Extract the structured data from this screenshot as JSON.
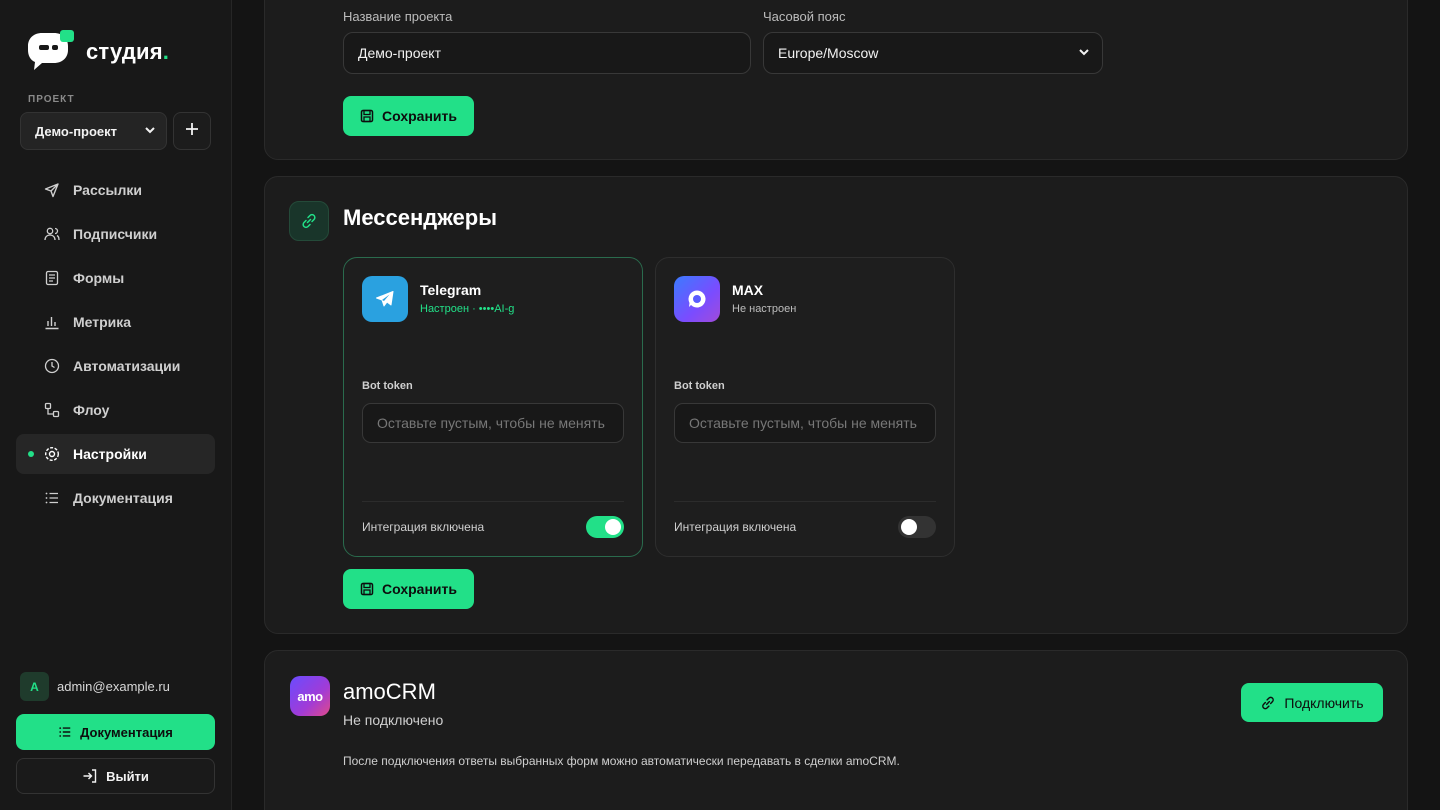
{
  "brand": {
    "name": "студия",
    "dot": ".",
    "accent": "#22e088"
  },
  "sidebar": {
    "project_label": "ПРОЕКТ",
    "project_select": "Демо-проект",
    "nav": [
      {
        "label": "Рассылки",
        "icon": "send-icon"
      },
      {
        "label": "Подписчики",
        "icon": "users-icon"
      },
      {
        "label": "Формы",
        "icon": "form-icon"
      },
      {
        "label": "Метрика",
        "icon": "chart-icon"
      },
      {
        "label": "Автоматизации",
        "icon": "clock-icon"
      },
      {
        "label": "Флоу",
        "icon": "flow-icon"
      },
      {
        "label": "Настройки",
        "icon": "settings-icon",
        "active": true
      },
      {
        "label": "Документация",
        "icon": "list-icon"
      }
    ],
    "user_initial": "A",
    "user_email": "admin@example.ru",
    "docs_button": "Документация",
    "logout_button": "Выйти"
  },
  "project_settings": {
    "name_label": "Название проекта",
    "name_value": "Демо-проект",
    "tz_label": "Часовой пояс",
    "tz_value": "Europe/Moscow",
    "save": "Сохранить"
  },
  "messengers": {
    "title": "Мессенджеры",
    "telegram": {
      "name": "Telegram",
      "status": "Настроен · ••••AI-g",
      "token_label": "Bot token",
      "token_placeholder": "Оставьте пустым, чтобы не менять",
      "toggle_label": "Интеграция включена",
      "enabled": true
    },
    "max": {
      "name": "MAX",
      "status": "Не настроен",
      "token_label": "Bot token",
      "token_placeholder": "Оставьте пустым, чтобы не менять",
      "toggle_label": "Интеграция включена",
      "enabled": false
    },
    "save": "Сохранить"
  },
  "amocrm": {
    "logo_text": "amo",
    "title": "amoCRM",
    "status": "Не подключено",
    "description": "После подключения ответы выбранных форм можно автоматически передавать в сделки amoCRM.",
    "connect": "Подключить"
  }
}
